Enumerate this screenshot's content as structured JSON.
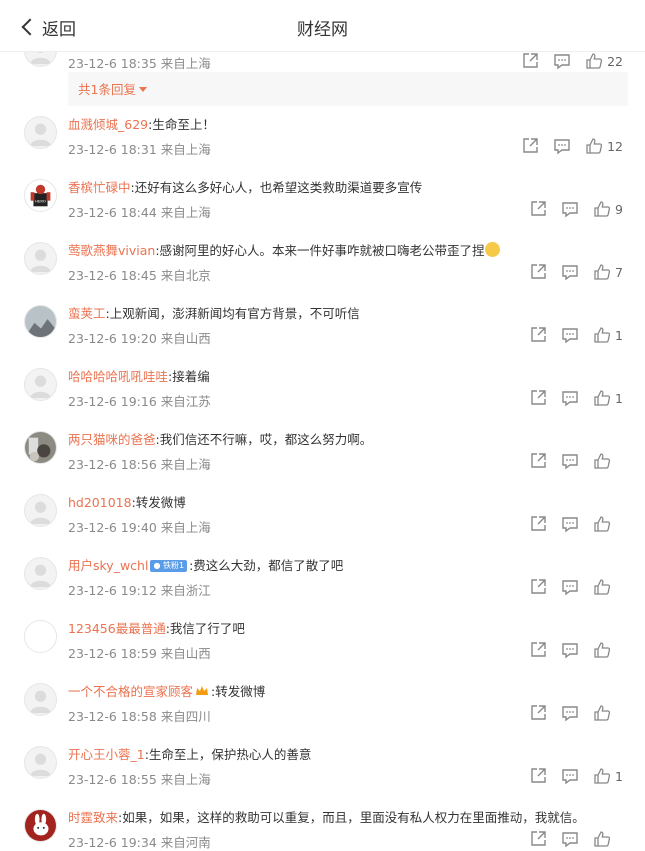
{
  "header": {
    "back_label": "返回",
    "title": "财经网"
  },
  "top_item": {
    "meta": "23-12-6 18:35 来自上海",
    "likes": "22"
  },
  "replies_toggle": "共1条回复",
  "comments": [
    {
      "user": "血溅倾城_629",
      "text": ":生命至上！",
      "meta": "23-12-6 18:31 来自上海",
      "likes": "12"
    },
    {
      "user": "香槟忙碌中",
      "text": ":还好有这么多好心人，也希望这类救助渠道要多宣传",
      "meta": "23-12-6 18:44 来自上海",
      "likes": "9"
    },
    {
      "user": "莺歌燕舞vivian",
      "text": ":感谢阿里的好心人。本来一件好事咋就被口嗨老公带歪了捏",
      "meta": "23-12-6 18:45 来自北京",
      "likes": "7"
    },
    {
      "user": "蛮荚工",
      "text": ":上观新闻，澎湃新闻均有官方背景，不可听信",
      "meta": "23-12-6 19:20 来自山西",
      "likes": "1"
    },
    {
      "user": "哈哈哈哈吼吼哇哇",
      "text": ":接着编",
      "meta": "23-12-6 19:16 来自江苏",
      "likes": "1"
    },
    {
      "user": "两只猫咪的爸爸",
      "text": ":我们信还不行嘛，哎，都这么努力啊。",
      "meta": "23-12-6 18:56 来自上海",
      "likes": ""
    },
    {
      "user": "hd201018",
      "text": ":转发微博",
      "meta": "23-12-6 19:40 来自上海",
      "likes": ""
    },
    {
      "user": "用户sky_wchl",
      "badge": "铁粉1",
      "text": ":费这么大劲，都信了散了吧",
      "meta": "23-12-6 19:12 来自浙江",
      "likes": ""
    },
    {
      "user": "123456最最普通",
      "text": ":我信了行了吧",
      "meta": "23-12-6 18:59 来自山西",
      "likes": ""
    },
    {
      "user": "一个不合格的宣家顾客",
      "text": ":转发微博",
      "meta": "23-12-6 18:58 来自四川",
      "likes": ""
    },
    {
      "user": "开心王小蓉_1",
      "text": ":生命至上，保护热心人的善意",
      "meta": "23-12-6 18:55 来自上海",
      "likes": "1"
    },
    {
      "user": "时霆致来",
      "text": ":如果，如果，这样的救助可以重复，而且，里面没有私人权力在里面推动，我就信。",
      "meta": "23-12-6 19:34 来自河南",
      "likes": ""
    }
  ],
  "colors": {
    "username": "#eb7350",
    "meta": "#8a8a8a",
    "accent": "#ffb400"
  }
}
